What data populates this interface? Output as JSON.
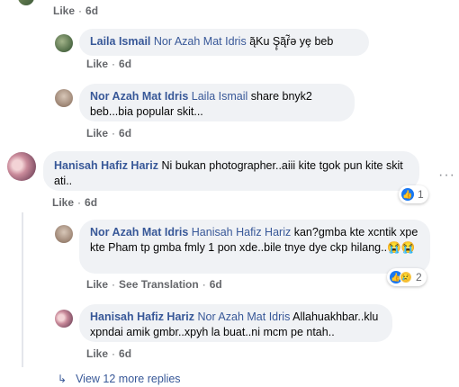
{
  "top_meta": {
    "like": "Like",
    "time": "6d"
  },
  "comments": [
    {
      "author": "Laila Ismail",
      "mention": "Nor Azah Mat Idris",
      "text": "ą̃Ku Ş̥ą̃ŕ̃ə yȩ beb",
      "like": "Like",
      "time": "6d"
    },
    {
      "author": "Nor Azah Mat Idris",
      "mention": "Laila Ismail",
      "text": "share bnyk2 beb...bia popular skit...",
      "like": "Like",
      "time": "6d"
    },
    {
      "author": "Hanisah Hafiz Hariz",
      "mention": "",
      "text": "Ni bukan photographer..aiii kite tgok pun kite skit ati..",
      "like": "Like",
      "time": "6d",
      "reactions": {
        "count": "1"
      }
    },
    {
      "author": "Nor Azah Mat Idris",
      "mention": "Hanisah Hafiz Hariz",
      "text": "kan?gmba kte xcntik xpe kte Pham tp gmba fmly 1 pon xde..bile tnye dye ckp hilang..😭😭",
      "like": "Like",
      "translation": "See Translation",
      "time": "6d",
      "reactions": {
        "count": "2"
      }
    },
    {
      "author": "Hanisah Hafiz Hariz",
      "mention": "Nor Azah Mat Idris",
      "text": "Allahuakhbar..klu xpndai amik gmbr..xpyh la buat..ni mcm pe ntah..",
      "like": "Like",
      "time": "6d"
    }
  ],
  "view_more": {
    "arrow": "↳",
    "label": "View 12 more replies"
  },
  "colors": {
    "link": "#385898",
    "bubble": "#f0f2f5",
    "meta": "#65676b",
    "like_blue": "#1877f2"
  }
}
